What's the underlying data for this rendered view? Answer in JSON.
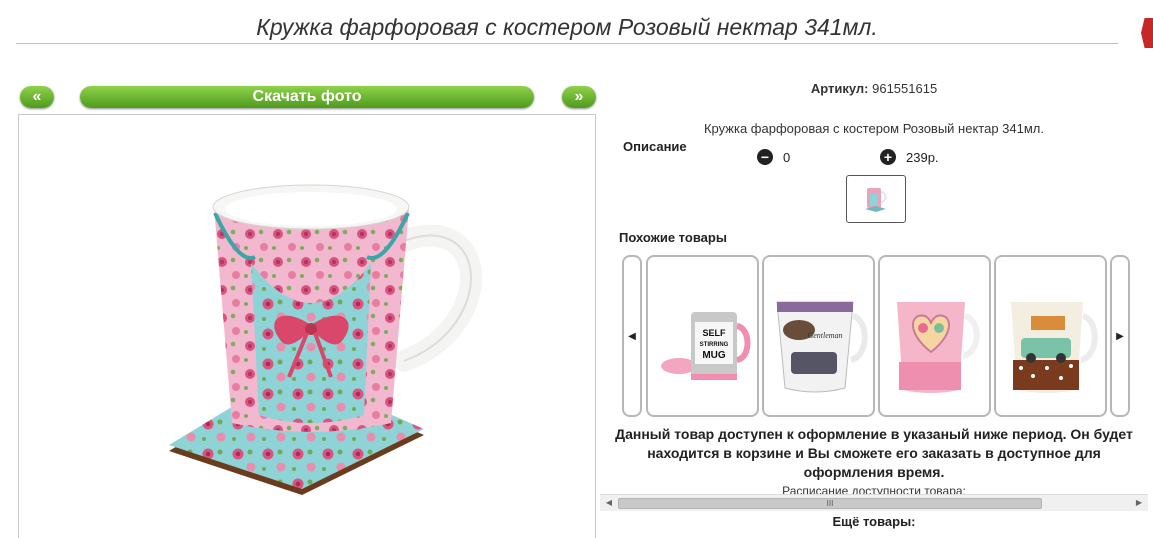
{
  "header": {
    "title": "Кружка фарфоровая с костером Розовый нектар 341мл."
  },
  "nav": {
    "prev_label": "«",
    "download_label": "Скачать фото",
    "next_label": "»"
  },
  "product": {
    "sku_label": "Артикул:",
    "sku_value": "961551615",
    "description": "Кружка фарфоровая с костером Розовый нектар 341мл.",
    "description_label": "Описание",
    "quantity": "0",
    "price": "239р."
  },
  "similar": {
    "title": "Похожие товары",
    "items": [
      {
        "label": "SELF STIRRING MUG"
      },
      {
        "label": "Gentleman"
      },
      {
        "label": ""
      },
      {
        "label": ""
      }
    ]
  },
  "notice": {
    "availability": "Данный товар доступен к оформление в указаный ниже период. Он будет находится в корзине и Вы сможете его заказать в доступное для оформления время.",
    "schedule": "Расписание доступности товара:",
    "scroll_label": "III"
  },
  "more": {
    "title": "Ещё товары:"
  },
  "colors": {
    "accent_green": "#5aa822",
    "danger_red": "#c62828"
  }
}
